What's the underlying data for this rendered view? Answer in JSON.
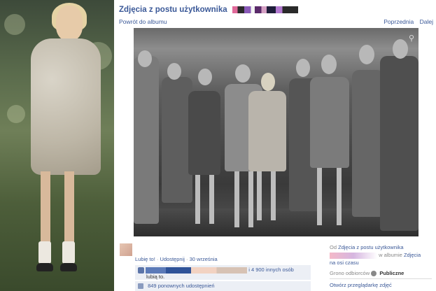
{
  "fb": {
    "title": "Zdjęcia z postu użytkownika",
    "back_link": "Powrót do albumu",
    "nav_prev": "Poprzednia",
    "nav_next": "Dalej",
    "icons": {
      "tag": "tag-icon",
      "like": "thumbs-up-icon",
      "share": "share-icon",
      "privacy": "globe-icon"
    },
    "accent_color": "#3b5998"
  },
  "post": {
    "like_link": "Lubię to!",
    "share_link": "Udostępnij",
    "separator": "·",
    "date": "30 września",
    "likes_text": "i 4 900 innych osób",
    "likes_text2": "lubią to.",
    "shares_text": "849 ponownych udostępnień"
  },
  "info": {
    "from_label": "Od",
    "from_link": "Zdjęcia z postu użytkownika",
    "album_prefix": "w albumie",
    "album_link": "Zdjęcia",
    "timeline_link": "na osi czasu",
    "audience_label": "Grono odbiorców",
    "audience_value": "Publiczne",
    "open_viewer": "Otwórz przeglądarkę zdjęć"
  }
}
